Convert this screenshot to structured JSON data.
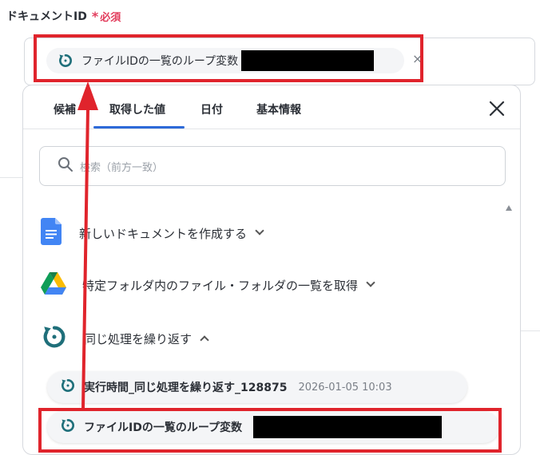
{
  "field": {
    "label": "ドキュメントID",
    "required_mark": "*",
    "required_text": "必須",
    "chip_label": "ファイルIDの一覧のループ変数",
    "remove_symbol": "×"
  },
  "tabs": [
    {
      "label": "候補"
    },
    {
      "label": "取得した値"
    },
    {
      "label": "日付"
    },
    {
      "label": "基本情報"
    }
  ],
  "search": {
    "placeholder": "検索（前方一致）"
  },
  "groups": [
    {
      "label": "新しいドキュメントを作成する",
      "icon": "google-docs-icon"
    },
    {
      "label": "特定フォルダ内のファイル・フォルダの一覧を取得",
      "icon": "google-drive-icon"
    },
    {
      "label": "同じ処理を繰り返す",
      "icon": "loop-icon"
    }
  ],
  "items": [
    {
      "label": "実行時間_同じ処理を繰り返す_128875",
      "time": "2026-01-05 10:03"
    },
    {
      "label": "ファイルIDの一覧のループ変数"
    }
  ],
  "colors": {
    "accent": "#2d6ad8",
    "highlight": "#e0242c",
    "loop_teal": "#1f6f7a",
    "required": "#e23c5c"
  }
}
